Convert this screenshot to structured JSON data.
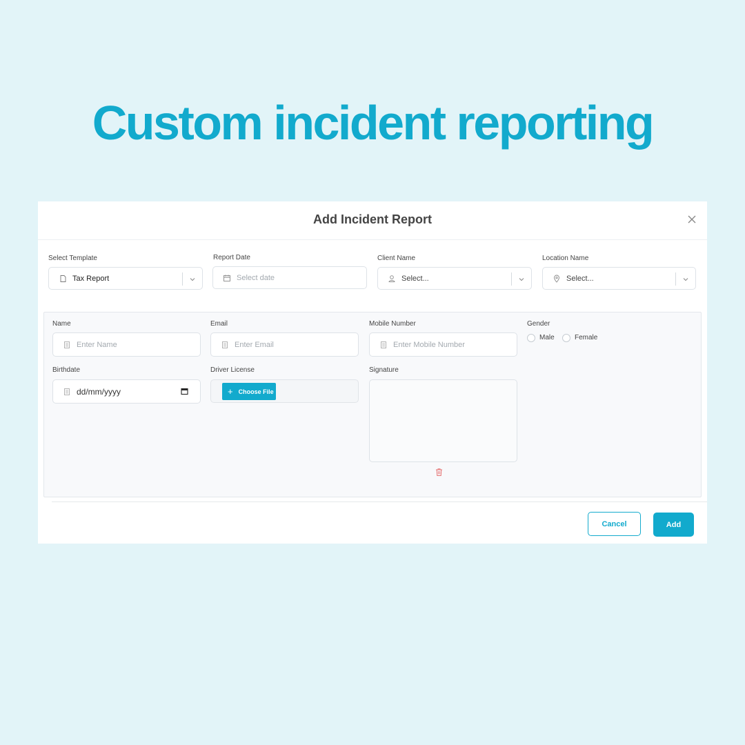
{
  "headline": "Custom incident reporting",
  "modal": {
    "title": "Add Incident Report",
    "close_icon": "close-icon"
  },
  "top_fields": {
    "template": {
      "label": "Select Template",
      "value": "Tax Report",
      "icon": "document-icon"
    },
    "report_date": {
      "label": "Report Date",
      "placeholder": "Select date",
      "icon": "calendar-icon"
    },
    "client_name": {
      "label": "Client Name",
      "placeholder": "Select...",
      "icon": "user-icon"
    },
    "location_name": {
      "label": "Location Name",
      "placeholder": "Select...",
      "icon": "location-pin-icon"
    }
  },
  "form": {
    "name": {
      "label": "Name",
      "placeholder": "Enter Name"
    },
    "email": {
      "label": "Email",
      "placeholder": "Enter Email"
    },
    "mobile": {
      "label": "Mobile Number",
      "placeholder": "Enter Mobile Number"
    },
    "gender": {
      "label": "Gender",
      "options": [
        "Male",
        "Female"
      ]
    },
    "birthdate": {
      "label": "Birthdate",
      "placeholder": "dd/mm/yyyy"
    },
    "driver_license": {
      "label": "Driver License",
      "button": "Choose File"
    },
    "signature": {
      "label": "Signature"
    }
  },
  "footer": {
    "cancel": "Cancel",
    "add": "Add"
  },
  "colors": {
    "accent": "#12aacd",
    "background": "#e2f4f8",
    "danger": "#e57373"
  }
}
